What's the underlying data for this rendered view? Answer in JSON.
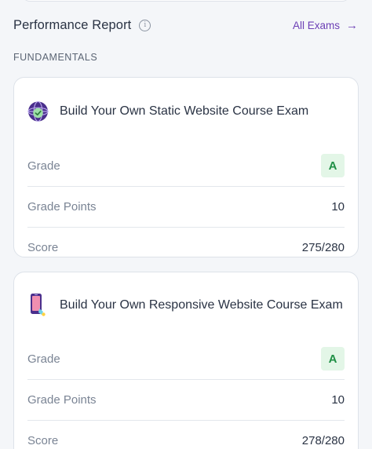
{
  "header": {
    "title": "Performance Report",
    "info_icon": "info-icon",
    "all_exams_label": "All Exams",
    "all_exams_icon": "arrow-right-icon"
  },
  "section": {
    "label": "FUNDAMENTALS"
  },
  "exams": [
    {
      "icon": "globe-icon",
      "title": "Build Your Own Static Website Course Exam",
      "grade_label": "Grade",
      "grade": "A",
      "grade_points_label": "Grade Points",
      "grade_points": "10",
      "score_label": "Score",
      "score": "275/280"
    },
    {
      "icon": "mobile-phone-icon",
      "title": "Build Your Own Responsive Website Course Exam",
      "grade_label": "Grade",
      "grade": "A",
      "grade_points_label": "Grade Points",
      "grade_points": "10",
      "score_label": "Score",
      "score": "278/280"
    }
  ],
  "colors": {
    "accent": "#6c3fb5",
    "grade_bg": "#e3f6e7",
    "grade_text": "#1f8f45",
    "page_bg": "#f4f6f9"
  }
}
